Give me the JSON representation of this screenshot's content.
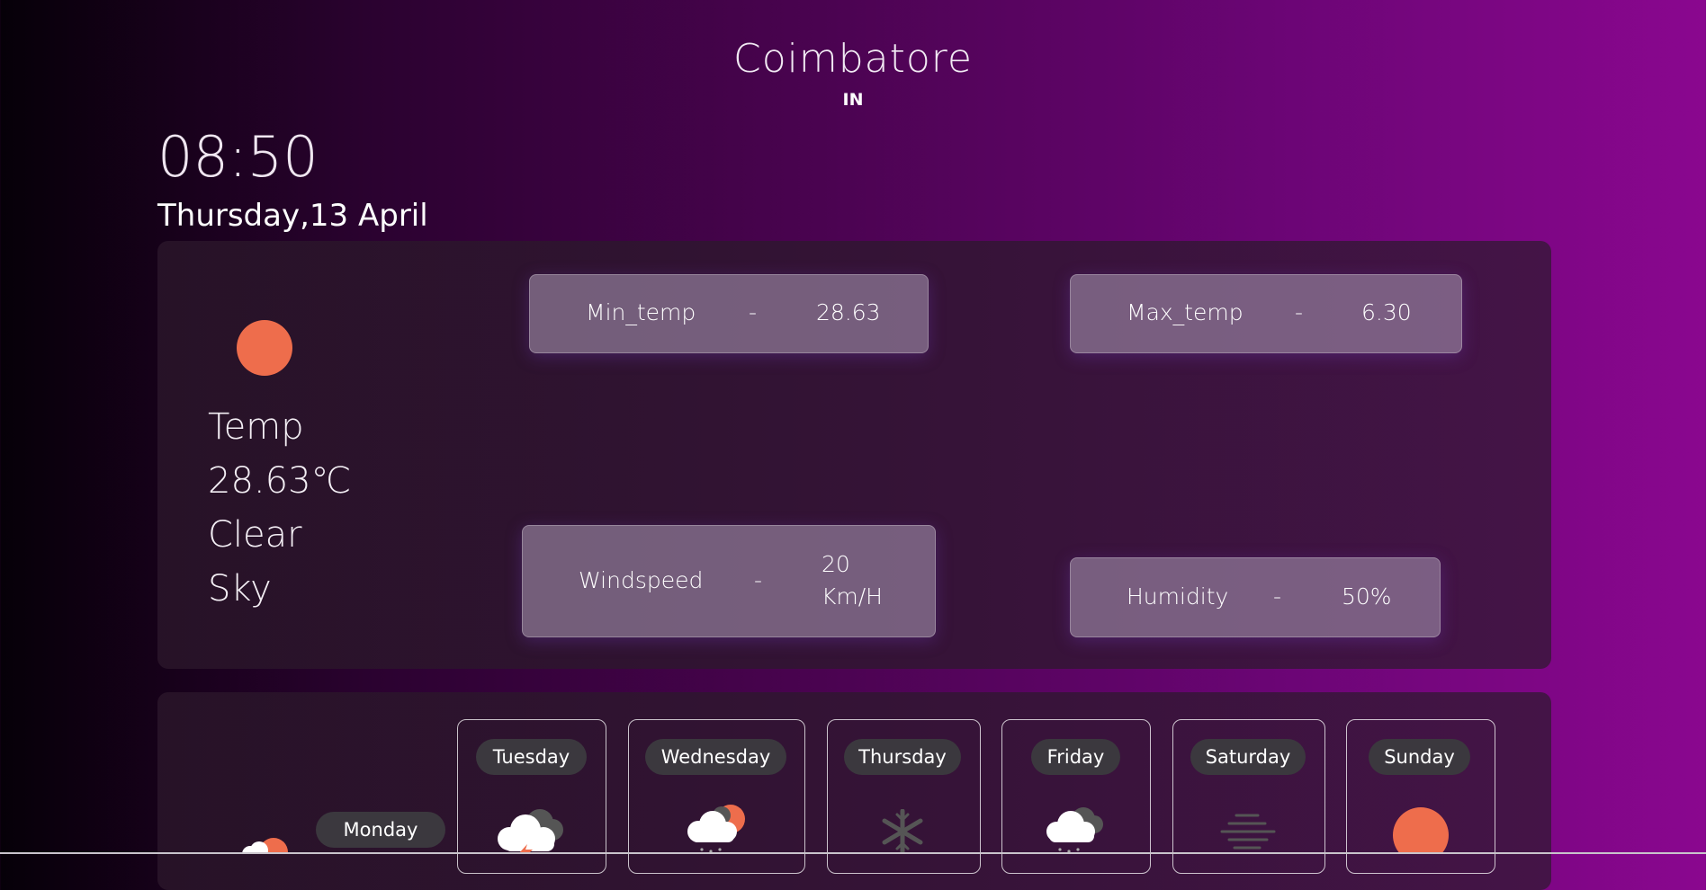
{
  "location": {
    "city": "Coimbatore",
    "country": "IN"
  },
  "clock": {
    "time": "08:50",
    "date": "Thursday,13 April"
  },
  "current": {
    "icon": "sun-icon",
    "label": "Temp",
    "temperature": "28.63℃",
    "condition_word1": "Clear",
    "condition_word2": "Sky"
  },
  "stats": {
    "min_temp": {
      "label": "Min_temp",
      "sep": "-",
      "value": "28.63"
    },
    "max_temp": {
      "label": "Max_temp",
      "sep": "-",
      "value": "6.30"
    },
    "windspeed": {
      "label": "Windspeed",
      "sep": "-",
      "value_line1": "20",
      "value_line2": "Km/H"
    },
    "humidity": {
      "label": "Humidity",
      "sep": "-",
      "value": "50%"
    }
  },
  "forecast": [
    {
      "day": "Monday",
      "icon": "sun-behind-cloud-icon"
    },
    {
      "day": "Tuesday",
      "icon": "thunderstorm-cloud-icon"
    },
    {
      "day": "Wednesday",
      "icon": "sun-cloud-rain-icon"
    },
    {
      "day": "Thursday",
      "icon": "snowflake-icon"
    },
    {
      "day": "Friday",
      "icon": "cloud-rain-icon"
    },
    {
      "day": "Saturday",
      "icon": "fog-icon"
    },
    {
      "day": "Sunday",
      "icon": "sun-icon"
    }
  ],
  "colors": {
    "sun": "#ee6d4c",
    "pill": "#3b383e",
    "stat_card": "#8f7a96"
  }
}
